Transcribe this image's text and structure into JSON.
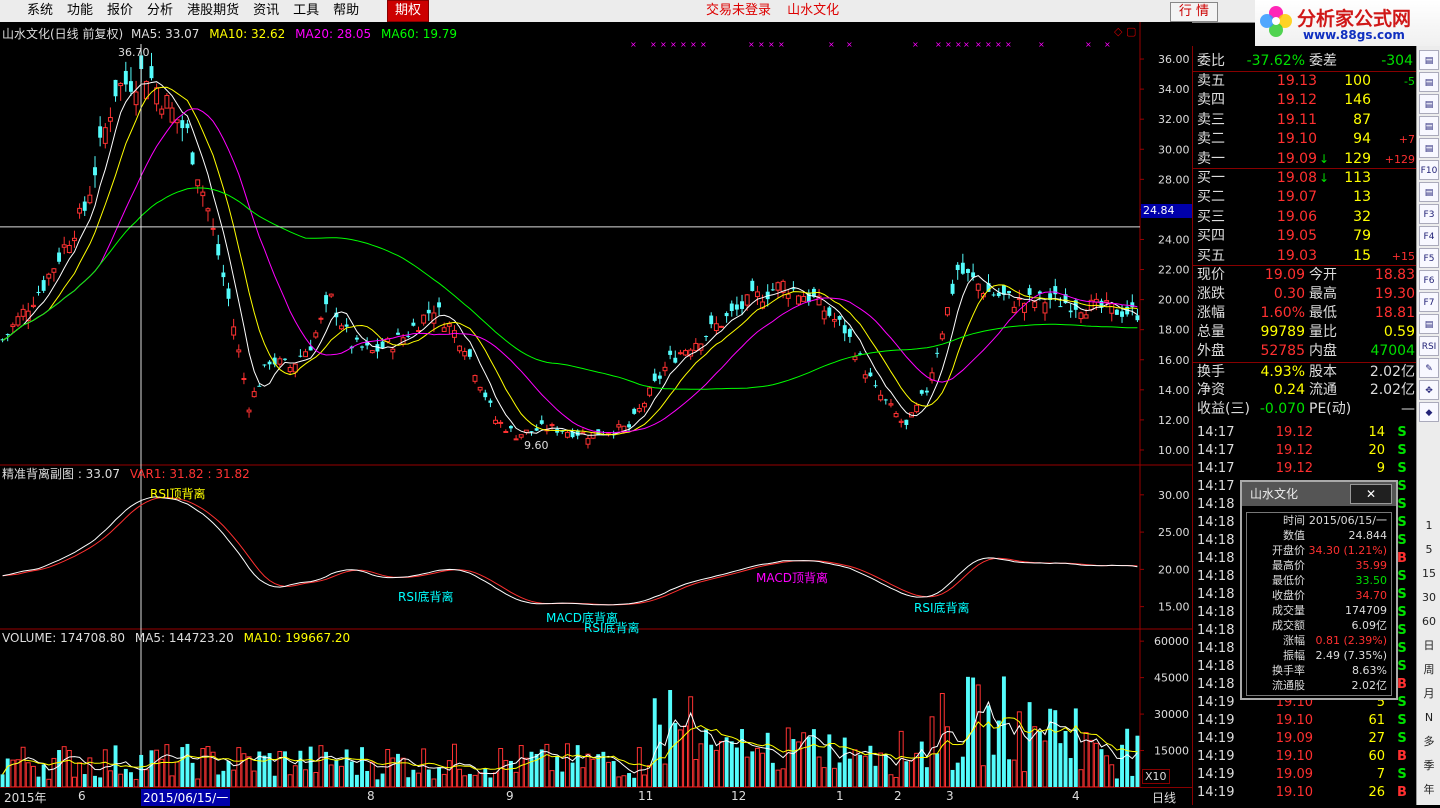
{
  "menu": {
    "items": [
      "系统",
      "功能",
      "报价",
      "分析",
      "港股期货",
      "资讯",
      "工具",
      "帮助"
    ],
    "active_item": "期权",
    "status_login": "交易未登录",
    "status_stock": "山水文化",
    "quote_button": "行 情"
  },
  "logo": {
    "title": "分析家公式网",
    "url_text": "www.88gs.com"
  },
  "main_chart": {
    "stock_label": "山水文化(日线 前复权)",
    "ma5": "MA5: 33.07",
    "ma10": "MA10: 32.62",
    "ma20": "MA20: 28.05",
    "ma60": "MA60: 19.79",
    "high_label": "36.70",
    "low_label": "9.60",
    "crosshair_price": "24.84",
    "y_ticks": [
      "36.00",
      "34.00",
      "32.00",
      "30.00",
      "28.00",
      "26.00",
      "24.00",
      "22.00",
      "20.00",
      "18.00",
      "16.00",
      "14.00",
      "12.00",
      "10.00"
    ]
  },
  "sub_chart": {
    "title": "精准背离副图 : 33.07",
    "var1": "VAR1: 31.82 : 31.82",
    "y_ticks": [
      "30.00",
      "25.00",
      "20.00",
      "15.00"
    ],
    "annotations": [
      "RSI顶背离",
      "RSI底背离",
      "MACD底背离",
      "RSI底背离",
      "MACD顶背离",
      "RSI底背离"
    ]
  },
  "volume_chart": {
    "title": "VOLUME: 174708.80",
    "ma5": "MA5: 144723.20",
    "ma10": "MA10: 199667.20",
    "y_ticks": [
      "60000",
      "45000",
      "30000",
      "15000"
    ],
    "unit": "X10"
  },
  "x_axis": {
    "labels": [
      "2015年",
      "6",
      "2015/06/15/一",
      "8",
      "9",
      "11",
      "12",
      "1",
      "2",
      "3",
      "4"
    ],
    "period": "日线"
  },
  "chart_data": [
    {
      "type": "line",
      "title": "山水文化(日线 前复权)",
      "ylim": [
        9,
        37
      ],
      "series": [
        {
          "name": "MA5",
          "last": 33.07
        },
        {
          "name": "MA10",
          "last": 32.62
        },
        {
          "name": "MA20",
          "last": 28.05
        },
        {
          "name": "MA60",
          "last": 19.79
        }
      ],
      "annotations": {
        "high": 36.7,
        "low": 9.6,
        "crosshair": 24.84
      }
    },
    {
      "type": "line",
      "title": "精准背离副图",
      "ylim": [
        12,
        34
      ],
      "series": [
        {
          "name": "VAR1",
          "last": 31.82
        }
      ]
    },
    {
      "type": "bar",
      "title": "VOLUME",
      "ylim": [
        0,
        65000
      ],
      "series": [
        {
          "name": "VOLUME",
          "last": 174708.8
        },
        {
          "name": "MA5",
          "last": 144723.2
        },
        {
          "name": "MA10",
          "last": 199667.2
        }
      ]
    }
  ],
  "quote": {
    "weibi": {
      "label": "委比",
      "value": "-37.62%",
      "label2": "委差",
      "value2": "-304"
    },
    "sells": [
      {
        "label": "卖五",
        "price": "19.13",
        "vol": "100",
        "chg": "-5"
      },
      {
        "label": "卖四",
        "price": "19.12",
        "vol": "146",
        "chg": ""
      },
      {
        "label": "卖三",
        "price": "19.11",
        "vol": "87",
        "chg": ""
      },
      {
        "label": "卖二",
        "price": "19.10",
        "vol": "94",
        "chg": "+7"
      },
      {
        "label": "卖一",
        "price": "19.09",
        "vol": "129",
        "chg": "+129"
      }
    ],
    "buys": [
      {
        "label": "买一",
        "price": "19.08",
        "vol": "113",
        "chg": ""
      },
      {
        "label": "买二",
        "price": "19.07",
        "vol": "13",
        "chg": ""
      },
      {
        "label": "买三",
        "price": "19.06",
        "vol": "32",
        "chg": ""
      },
      {
        "label": "买四",
        "price": "19.05",
        "vol": "79",
        "chg": ""
      },
      {
        "label": "买五",
        "price": "19.03",
        "vol": "15",
        "chg": "+15"
      }
    ],
    "stats": [
      {
        "k1": "现价",
        "v1": "19.09",
        "k2": "今开",
        "v2": "18.83"
      },
      {
        "k1": "涨跌",
        "v1": "0.30",
        "k2": "最高",
        "v2": "19.30"
      },
      {
        "k1": "涨幅",
        "v1": "1.60%",
        "k2": "最低",
        "v2": "18.81"
      },
      {
        "k1": "总量",
        "v1": "99789",
        "k2": "量比",
        "v2": "0.59"
      },
      {
        "k1": "外盘",
        "v1": "52785",
        "k2": "内盘",
        "v2": "47004"
      },
      {
        "k1": "换手",
        "v1": "4.93%",
        "k2": "股本",
        "v2": "2.02亿"
      },
      {
        "k1": "净资",
        "v1": "0.24",
        "k2": "流通",
        "v2": "2.02亿"
      },
      {
        "k1": "收益(三)",
        "v1": "-0.070",
        "k2": "PE(动)",
        "v2": "—"
      }
    ]
  },
  "ticks": [
    {
      "time": "14:17",
      "price": "19.12",
      "vol": "14",
      "side": "S"
    },
    {
      "time": "14:17",
      "price": "19.12",
      "vol": "20",
      "side": "S"
    },
    {
      "time": "14:17",
      "price": "19.12",
      "vol": "9",
      "side": "S"
    },
    {
      "time": "14:17",
      "price": "",
      "vol": "",
      "side": "S"
    },
    {
      "time": "14:18",
      "price": "",
      "vol": "",
      "side": "S"
    },
    {
      "time": "14:18",
      "price": "",
      "vol": "",
      "side": "S"
    },
    {
      "time": "14:18",
      "price": "",
      "vol": "",
      "side": "S"
    },
    {
      "time": "14:18",
      "price": "",
      "vol": "",
      "side": "B"
    },
    {
      "time": "14:18",
      "price": "",
      "vol": "",
      "side": "S"
    },
    {
      "time": "14:18",
      "price": "",
      "vol": "",
      "side": "S"
    },
    {
      "time": "14:18",
      "price": "",
      "vol": "",
      "side": "S"
    },
    {
      "time": "14:18",
      "price": "",
      "vol": "",
      "side": "S"
    },
    {
      "time": "14:18",
      "price": "",
      "vol": "",
      "side": "S"
    },
    {
      "time": "14:18",
      "price": "",
      "vol": "",
      "side": "S"
    },
    {
      "time": "14:18",
      "price": "",
      "vol": "",
      "side": "B"
    },
    {
      "time": "14:19",
      "price": "19.10",
      "vol": "5",
      "side": "S"
    },
    {
      "time": "14:19",
      "price": "19.10",
      "vol": "61",
      "side": "S"
    },
    {
      "time": "14:19",
      "price": "19.09",
      "vol": "27",
      "side": "S"
    },
    {
      "time": "14:19",
      "price": "19.10",
      "vol": "60",
      "side": "B"
    },
    {
      "time": "14:19",
      "price": "19.09",
      "vol": "7",
      "side": "S"
    },
    {
      "time": "14:19",
      "price": "19.10",
      "vol": "26",
      "side": "B"
    }
  ],
  "popup": {
    "title": "山水文化",
    "close": "✕",
    "rows": [
      {
        "k": "时间",
        "v": "2015/06/15/一",
        "c": "#dddddd"
      },
      {
        "k": "数值",
        "v": "24.844",
        "c": "#dddddd"
      },
      {
        "k": "开盘价",
        "v": "34.30 (1.21%)",
        "c": "#ff3030"
      },
      {
        "k": "最高价",
        "v": "35.99",
        "c": "#ff3030"
      },
      {
        "k": "最低价",
        "v": "33.50",
        "c": "#00e000"
      },
      {
        "k": "收盘价",
        "v": "34.70",
        "c": "#ff3030"
      },
      {
        "k": "成交量",
        "v": "174709",
        "c": "#dddddd"
      },
      {
        "k": "成交额",
        "v": "6.09亿",
        "c": "#dddddd"
      },
      {
        "k": "涨幅",
        "v": "0.81 (2.39%)",
        "c": "#ff3030"
      },
      {
        "k": "振幅",
        "v": "2.49 (7.35%)",
        "c": "#dddddd"
      },
      {
        "k": "换手率",
        "v": "8.63%",
        "c": "#dddddd"
      },
      {
        "k": "流通股",
        "v": "2.02亿",
        "c": "#dddddd"
      }
    ]
  },
  "toolbar": {
    "periods": [
      "1",
      "5",
      "15",
      "30",
      "60",
      "日",
      "周",
      "月",
      "N",
      "多",
      "季",
      "年"
    ],
    "tools": [
      "RSI"
    ]
  }
}
